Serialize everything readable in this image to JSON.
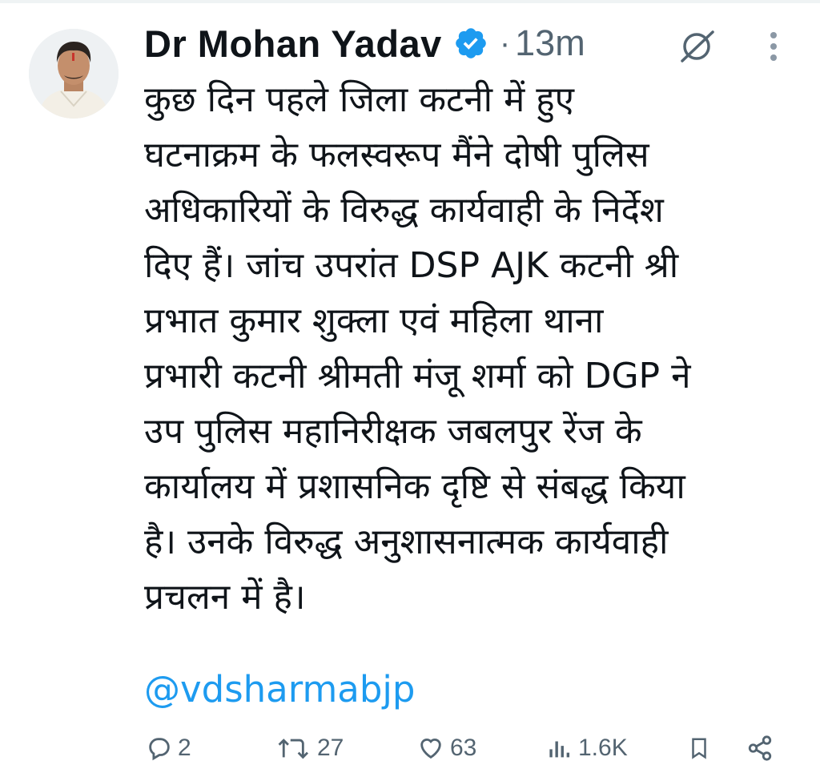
{
  "author": {
    "display_name": "Dr Mohan Yadav",
    "verified": true,
    "separator": "·",
    "timestamp": "13m",
    "avatar_icon": "profile-photo"
  },
  "tweet": {
    "lines": [
      "कुछ दिन पहले जिला कटनी में हुए",
      "घटनाक्रम के फलस्वरूप मैंने दोषी पुलिस",
      "अधिकारियों के विरुद्ध कार्यवाही के निर्देश",
      "दिए हैं। जांच उपरांत DSP AJK कटनी श्री",
      "प्रभात कुमार शुक्ला एवं महिला थाना",
      "प्रभारी कटनी श्रीमती मंजू शर्मा को DGP ने",
      "उप पुलिस महानिरीक्षक जबलपुर रेंज के",
      "कार्यालय में प्रशासनिक दृष्टि से संबद्ध किया",
      "है। उनके विरुद्ध अनुशासनात्मक कार्यवाही",
      "प्रचलन में है।"
    ],
    "mention": "@vdsharmabjp"
  },
  "actions": {
    "replies": "2",
    "reposts": "27",
    "likes": "63",
    "views": "1.6K"
  },
  "colors": {
    "text": "#0f1419",
    "secondary": "#536471",
    "link": "#1d9bf0",
    "verified": "#1d9bf0"
  }
}
